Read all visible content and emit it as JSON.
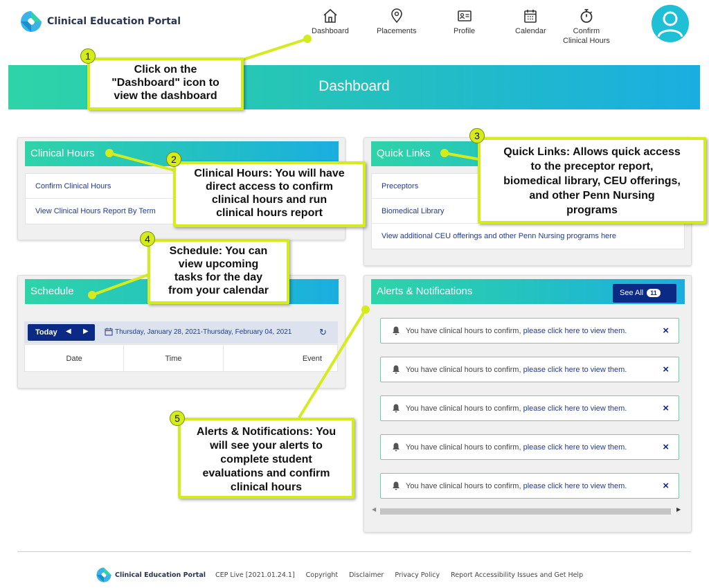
{
  "header": {
    "brand": "Clinical Education Portal",
    "nav": [
      {
        "label": "Dashboard",
        "icon": "home-icon"
      },
      {
        "label": "Placements",
        "icon": "map-pin-icon"
      },
      {
        "label": "Profile",
        "icon": "id-card-icon"
      },
      {
        "label": "Calendar",
        "icon": "calendar-icon"
      },
      {
        "label_line1": "Confirm",
        "label_line2": "Clinical Hours",
        "icon": "stopwatch-icon"
      }
    ],
    "avatar_icon": "user-avatar-icon"
  },
  "banner": {
    "title": "Dashboard"
  },
  "clinical_hours": {
    "title": "Clinical Hours",
    "links": [
      "Confirm Clinical Hours",
      "View Clinical Hours Report By Term"
    ]
  },
  "quick_links": {
    "title": "Quick Links",
    "links": [
      "Preceptors",
      "Biomedical Library",
      "View additional CEU offerings and other Penn Nursing programs here"
    ]
  },
  "schedule": {
    "title": "Schedule",
    "today_label": "Today",
    "date_range": "Thursday, January 28, 2021-Thursday, February 04, 2021",
    "columns": [
      "Date",
      "Time",
      "Event"
    ]
  },
  "alerts": {
    "title": "Alerts & Notifications",
    "see_all_label": "See All",
    "count": "11",
    "items": [
      {
        "text": "You have clinical hours to confirm, ",
        "link": "please click here to view them."
      },
      {
        "text": "You have clinical hours to confirm, ",
        "link": "please click here to view them."
      },
      {
        "text": "You have clinical hours to confirm, ",
        "link": "please click here to view them."
      },
      {
        "text": "You have clinical hours to confirm, ",
        "link": "please click here to view them."
      },
      {
        "text": "You have clinical hours to confirm, ",
        "link": "please click here to view them."
      }
    ],
    "close_glyph": "×"
  },
  "callouts": [
    {
      "num": "1",
      "lines": [
        "Click on the",
        "\"Dashboard\" icon to",
        "view the dashboard"
      ]
    },
    {
      "num": "2",
      "lines": [
        "Clinical Hours: You will have",
        "direct access to confirm",
        "clinical hours and run",
        "clinical hours report"
      ]
    },
    {
      "num": "3",
      "lines": [
        "Quick Links: Allows quick access",
        "to the preceptor report,",
        "biomedical library, CEU offerings,",
        "and other Penn Nursing",
        "programs"
      ]
    },
    {
      "num": "4",
      "lines": [
        "Schedule: You can",
        "view upcoming",
        "tasks for the day",
        "from your calendar"
      ]
    },
    {
      "num": "5",
      "lines": [
        "Alerts & Notifications: You",
        "will see your alerts to",
        "complete student",
        "evaluations and confirm",
        "clinical hours"
      ]
    }
  ],
  "footer": {
    "brand": "Clinical Education Portal",
    "version": "CEP Live [2021.01.24.1]",
    "links": [
      "Copyright",
      "Disclaimer",
      "Privacy Policy",
      "Report Accessibility Issues and Get Help"
    ]
  },
  "colors": {
    "accent_navy": "#0b2a86",
    "gradient_start": "#2ed4a8",
    "gradient_end": "#1aaee0",
    "callout": "#d4ec1e"
  }
}
